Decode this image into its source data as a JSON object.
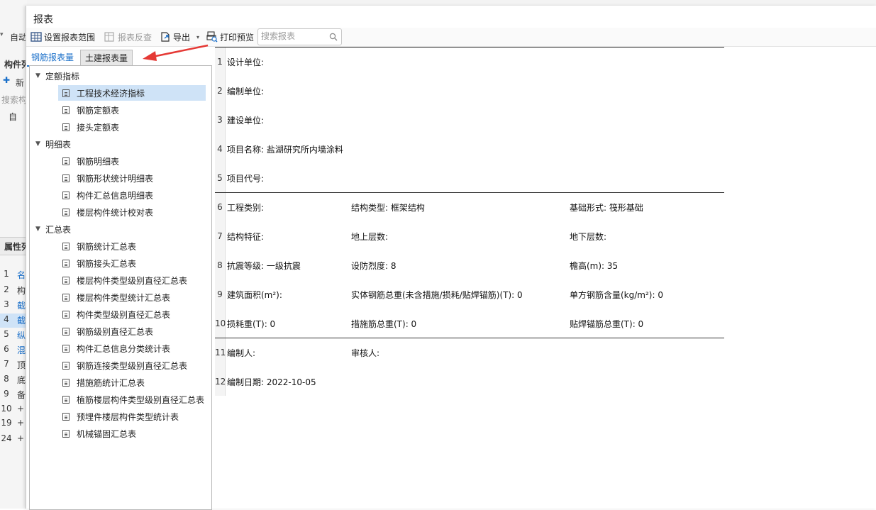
{
  "background": {
    "toolbar_label": "自动",
    "panel_title": "构件列",
    "new_label": "新",
    "search_label": "搜索构",
    "tree_item": "自",
    "props_title": "属性列",
    "rows": [
      {
        "num": "1",
        "text": "名"
      },
      {
        "num": "2",
        "text": "构"
      },
      {
        "num": "3",
        "text": "截"
      },
      {
        "num": "4",
        "text": "截"
      },
      {
        "num": "5",
        "text": "纵"
      },
      {
        "num": "6",
        "text": "混"
      },
      {
        "num": "7",
        "text": "顶"
      },
      {
        "num": "8",
        "text": "底"
      },
      {
        "num": "9",
        "text": "备"
      },
      {
        "num": "10",
        "text": "+"
      },
      {
        "num": "19",
        "text": "+"
      },
      {
        "num": "24",
        "text": "+"
      }
    ]
  },
  "dialog": {
    "title": "报表",
    "toolbar": {
      "set_range": "设置报表范围",
      "reverse_check": "报表反查",
      "export": "导出",
      "print_preview": "打印预览",
      "search_placeholder": "搜索报表"
    },
    "tabs": [
      "钢筋报表量",
      "土建报表量"
    ],
    "tree": [
      {
        "group": "定额指标",
        "items": [
          "工程技术经济指标",
          "钢筋定额表",
          "接头定额表"
        ]
      },
      {
        "group": "明细表",
        "items": [
          "钢筋明细表",
          "钢筋形状统计明细表",
          "构件汇总信息明细表",
          "楼层构件统计校对表"
        ]
      },
      {
        "group": "汇总表",
        "items": [
          "钢筋统计汇总表",
          "钢筋接头汇总表",
          "楼层构件类型级别直径汇总表",
          "楼层构件类型统计汇总表",
          "构件类型级别直径汇总表",
          "钢筋级别直径汇总表",
          "构件汇总信息分类统计表",
          "钢筋连接类型级别直径汇总表",
          "措施筋统计汇总表",
          "植筋楼层构件类型级别直径汇总表",
          "预埋件楼层构件类型统计表",
          "机械锚固汇总表"
        ]
      }
    ],
    "selected_item": "工程技术经济指标"
  },
  "report": {
    "rows": [
      {
        "num": "1",
        "cells": [
          "设计单位:"
        ]
      },
      {
        "num": "2",
        "cells": [
          "编制单位:"
        ]
      },
      {
        "num": "3",
        "cells": [
          "建设单位:"
        ]
      },
      {
        "num": "4",
        "cells": [
          "项目名称: 盐湖研究所内墙涂料"
        ]
      },
      {
        "num": "5",
        "cells": [
          "项目代号:"
        ]
      },
      {
        "num": "6",
        "cells": [
          "工程类别:",
          "结构类型: 框架结构",
          "基础形式: 筏形基础"
        ]
      },
      {
        "num": "7",
        "cells": [
          "结构特征:",
          "地上层数:",
          "地下层数:"
        ]
      },
      {
        "num": "8",
        "cells": [
          "抗震等级: 一级抗震",
          "设防烈度: 8",
          "檐高(m): 35"
        ]
      },
      {
        "num": "9",
        "cells": [
          "建筑面积(m²):",
          "实体钢筋总重(未含措施/损耗/贴焊锚筋)(T): 0",
          "单方钢筋含量(kg/m²): 0"
        ]
      },
      {
        "num": "10",
        "cells": [
          "损耗重(T): 0",
          "措施筋总重(T): 0",
          "贴焊锚筋总重(T): 0"
        ]
      },
      {
        "num": "11",
        "cells": [
          "编制人:",
          "审核人:"
        ]
      },
      {
        "num": "12",
        "cells": [
          "编制日期: 2022-10-05"
        ]
      }
    ]
  },
  "colors": {
    "accent": "#1a6fc9",
    "selected_bg": "#cfe3f7",
    "arrow": "#e53935"
  }
}
